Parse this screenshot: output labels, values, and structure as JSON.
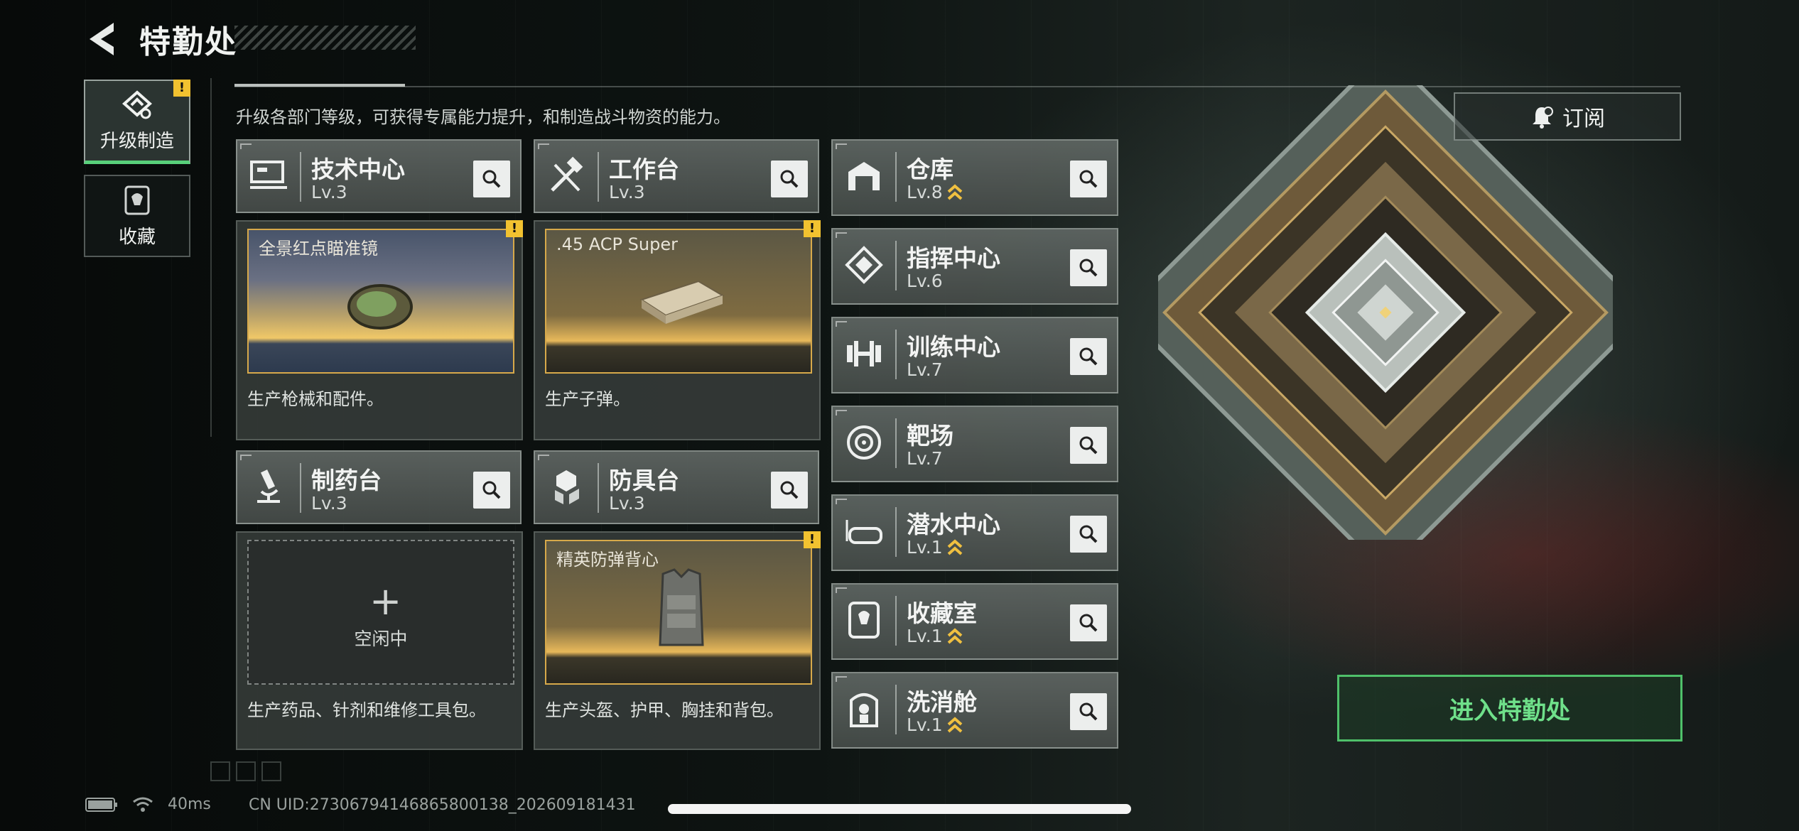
{
  "header": {
    "title": "特勤处",
    "description": "升级各部门等级，可获得专属能力提升，和制造战斗物资的能力。"
  },
  "nav": {
    "items": [
      {
        "label": "升级制造",
        "icon": "upgrade-craft-icon",
        "active": true,
        "alert": "!"
      },
      {
        "label": "收藏",
        "icon": "collection-icon",
        "active": false
      }
    ]
  },
  "departments": {
    "tech": {
      "name": "技术中心",
      "level": "Lv.3",
      "icon": "computer-workstation-icon",
      "product": "全景红点瞄准镜",
      "caption": "生产枪械和配件。",
      "alert": "!"
    },
    "workbench": {
      "name": "工作台",
      "level": "Lv.3",
      "icon": "hammer-wrench-icon",
      "product": ".45 ACP Super",
      "caption": "生产子弹。",
      "alert": "!"
    },
    "pharmacy": {
      "name": "制药台",
      "level": "Lv.3",
      "icon": "microscope-icon",
      "idle": "空闲中",
      "caption": "生产药品、针剂和维修工具包。"
    },
    "armor": {
      "name": "防具台",
      "level": "Lv.3",
      "icon": "armor-cubes-icon",
      "product": "精英防弹背心",
      "caption": "生产头盔、护甲、胸挂和背包。",
      "alert": "!"
    },
    "side": [
      {
        "name": "仓库",
        "level": "Lv.8",
        "icon": "warehouse-icon",
        "upgradable": true
      },
      {
        "name": "指挥中心",
        "level": "Lv.6",
        "icon": "command-center-icon",
        "upgradable": false
      },
      {
        "name": "训练中心",
        "level": "Lv.7",
        "icon": "dumbbell-icon",
        "upgradable": false
      },
      {
        "name": "靶场",
        "level": "Lv.7",
        "icon": "target-icon",
        "upgradable": false
      },
      {
        "name": "潜水中心",
        "level": "Lv.1",
        "icon": "diving-goggles-icon",
        "upgradable": true
      },
      {
        "name": "收藏室",
        "level": "Lv.1",
        "icon": "display-case-icon",
        "upgradable": true
      },
      {
        "name": "洗消舱",
        "level": "Lv.1",
        "icon": "decontamination-pod-icon",
        "upgradable": true
      }
    ]
  },
  "right": {
    "subscribe": "订阅",
    "enter": "进入特勤处"
  },
  "status": {
    "ping": "40ms",
    "uid": "CN UID:27306794146865800138_202609181431"
  },
  "colors": {
    "accent_green": "#58d07a",
    "alert_yellow": "#f2c230",
    "gold_frame": "#d7a94a"
  }
}
